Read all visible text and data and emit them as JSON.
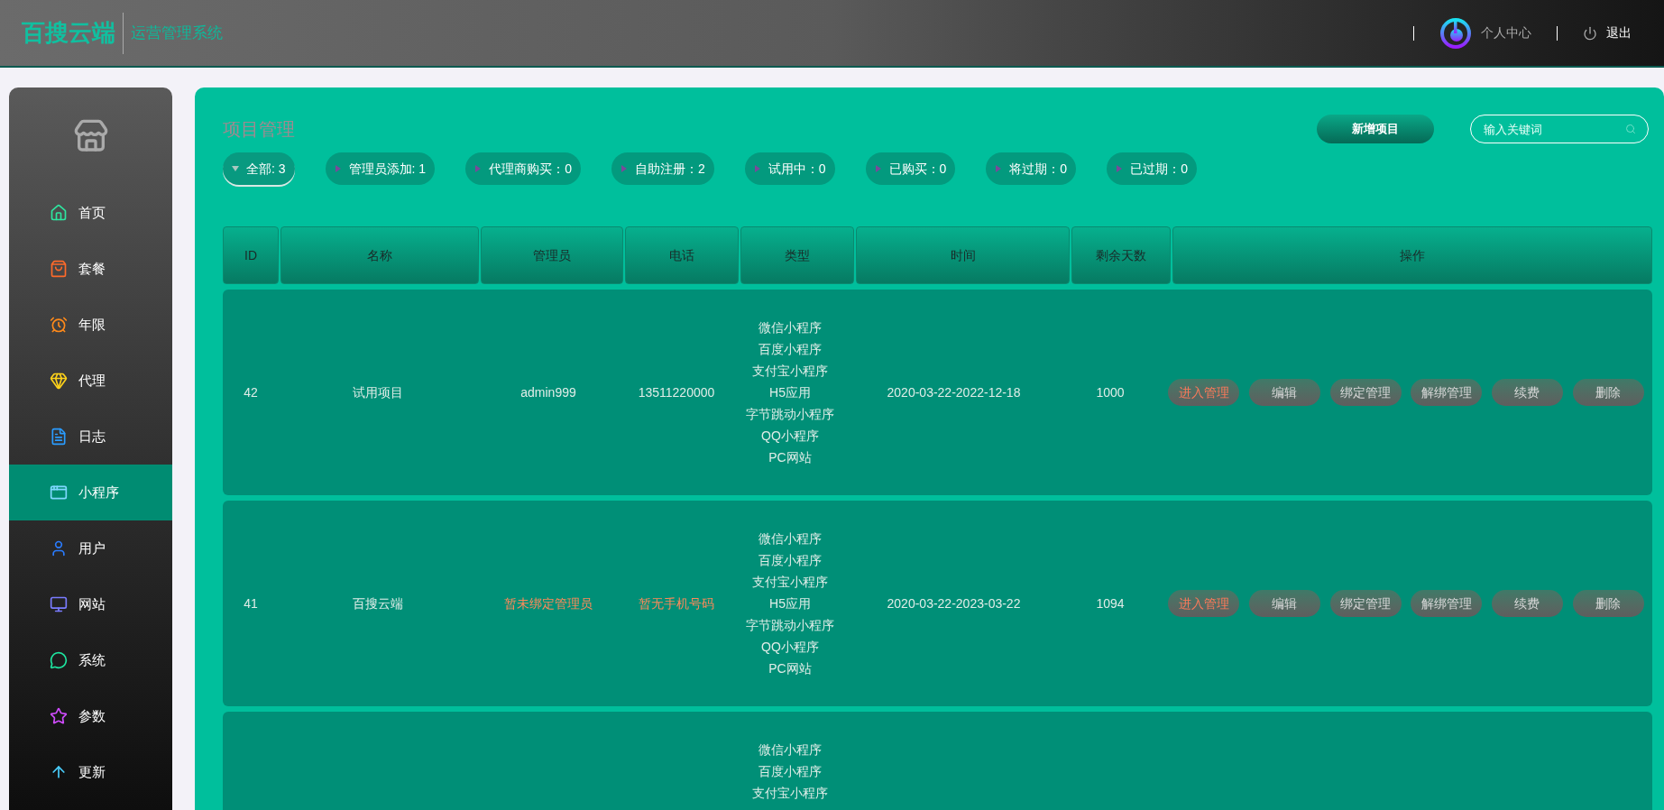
{
  "header": {
    "brand": "百搜云端",
    "subtitle": "运营管理系统",
    "user_link": "个人中心",
    "logout": "退出"
  },
  "sidebar": {
    "items": [
      {
        "label": "首页",
        "selected": false
      },
      {
        "label": "套餐",
        "selected": false
      },
      {
        "label": "年限",
        "selected": false
      },
      {
        "label": "代理",
        "selected": false
      },
      {
        "label": "日志",
        "selected": false
      },
      {
        "label": "小程序",
        "selected": true
      },
      {
        "label": "用户",
        "selected": false
      },
      {
        "label": "网站",
        "selected": false
      },
      {
        "label": "系统",
        "selected": false
      },
      {
        "label": "参数",
        "selected": false
      },
      {
        "label": "更新",
        "selected": false
      }
    ]
  },
  "page": {
    "title": "项目管理",
    "add_button": "新增项目",
    "search": {
      "placeholder": "输入关键词"
    }
  },
  "filters": [
    {
      "label": "全部: 3",
      "selected": true
    },
    {
      "label": "管理员添加: 1",
      "selected": false
    },
    {
      "label": "代理商购买：0",
      "selected": false
    },
    {
      "label": "自助注册：2",
      "selected": false
    },
    {
      "label": "试用中：0",
      "selected": false
    },
    {
      "label": "已购买：0",
      "selected": false
    },
    {
      "label": "将过期：0",
      "selected": false
    },
    {
      "label": "已过期：0",
      "selected": false
    }
  ],
  "table": {
    "columns": [
      "ID",
      "名称",
      "管理员",
      "电话",
      "类型",
      "时间",
      "剩余天数",
      "操作"
    ],
    "rows": [
      {
        "id": "42",
        "name": "试用项目",
        "admin": {
          "text": "admin999",
          "missing": false
        },
        "phone": {
          "text": "13511220000",
          "missing": false
        },
        "types": [
          "微信小程序",
          "百度小程序",
          "支付宝小程序",
          "H5应用",
          "字节跳动小程序",
          "QQ小程序",
          "PC网站"
        ],
        "time": "2020-03-22-2022-12-18",
        "days": "1000",
        "actions": [
          {
            "label": "进入管理",
            "kind": "primary"
          },
          {
            "label": "编辑",
            "kind": "normal"
          },
          {
            "label": "绑定管理",
            "kind": "normal"
          },
          {
            "label": "解绑管理",
            "kind": "normal"
          },
          {
            "label": "续费",
            "kind": "normal"
          },
          {
            "label": "删除",
            "kind": "normal"
          }
        ]
      },
      {
        "id": "41",
        "name": "百搜云端",
        "admin": {
          "text": "暂未绑定管理员",
          "missing": true
        },
        "phone": {
          "text": "暂无手机号码",
          "missing": true
        },
        "types": [
          "微信小程序",
          "百度小程序",
          "支付宝小程序",
          "H5应用",
          "字节跳动小程序",
          "QQ小程序",
          "PC网站"
        ],
        "time": "2020-03-22-2023-03-22",
        "days": "1094",
        "actions": [
          {
            "label": "进入管理",
            "kind": "primary"
          },
          {
            "label": "编辑",
            "kind": "normal"
          },
          {
            "label": "绑定管理",
            "kind": "normal"
          },
          {
            "label": "解绑管理",
            "kind": "normal"
          },
          {
            "label": "续费",
            "kind": "normal"
          },
          {
            "label": "删除",
            "kind": "normal"
          }
        ]
      },
      {
        "types": [
          "微信小程序",
          "百度小程序",
          "支付宝小程序"
        ]
      }
    ]
  }
}
